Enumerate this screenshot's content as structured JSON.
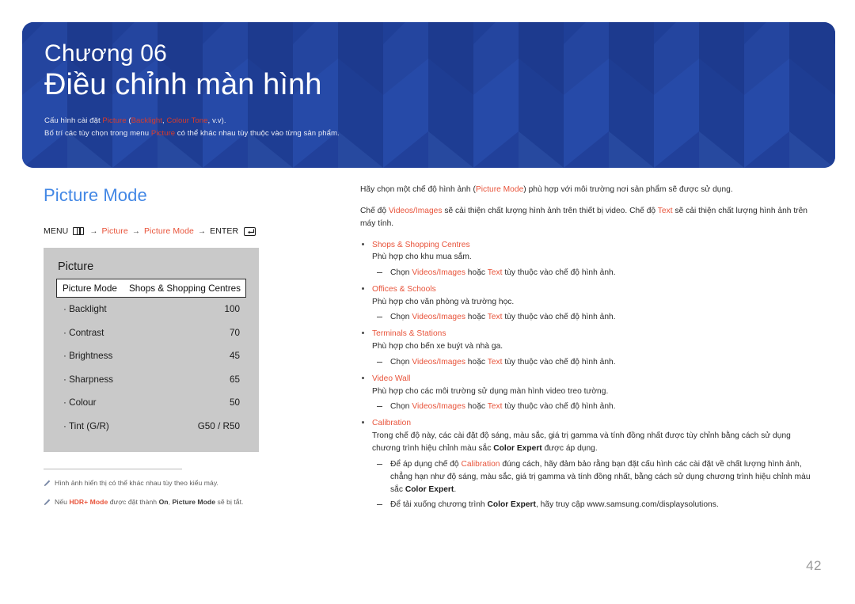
{
  "banner": {
    "chapter_label": "Chương 06",
    "chapter_title": "Điều chỉnh màn hình",
    "note_line1_a": "Cấu hình cài đặt ",
    "note_line1_picture": "Picture",
    "note_line1_b": " (",
    "note_line1_backlight": "Backlight",
    "note_line1_c": ", ",
    "note_line1_colourtone": "Colour Tone",
    "note_line1_d": ", v.v).",
    "note_line2_a": "Bố trí các tùy chọn trong menu ",
    "note_line2_picture": "Picture",
    "note_line2_b": " có thể khác nhau tùy thuộc vào từng sản phẩm.",
    "bg_color": "#21409a",
    "accent_color": "#d93b2b"
  },
  "section": {
    "title": "Picture Mode",
    "title_color": "#4287e5"
  },
  "menu_path": {
    "menu_label": "MENU",
    "menu_icon": "menu-grid-icon",
    "arrow": "→",
    "item1": "Picture",
    "item2": "Picture Mode",
    "enter_label": "ENTER",
    "enter_icon": "enter-return-icon",
    "accent_color": "#e8533a"
  },
  "osd": {
    "title": "Picture",
    "selected_row": {
      "label": "Picture Mode",
      "value": "Shops & Shopping Centres"
    },
    "rows": [
      {
        "label": "Backlight",
        "value": "100"
      },
      {
        "label": "Contrast",
        "value": "70"
      },
      {
        "label": "Brightness",
        "value": "45"
      },
      {
        "label": "Sharpness",
        "value": "65"
      },
      {
        "label": "Colour",
        "value": "50"
      },
      {
        "label": "Tint (G/R)",
        "value": "G50 / R50"
      }
    ],
    "bg_color": "#c9c9c9"
  },
  "footnotes": [
    {
      "icon": "pencil-icon",
      "parts": [
        {
          "text": "Hình ảnh hiển thị có thể khác nhau tùy theo kiểu máy.",
          "style": "normal"
        }
      ]
    },
    {
      "icon": "pencil-icon",
      "parts": [
        {
          "text": "Nếu ",
          "style": "normal"
        },
        {
          "text": "HDR+ Mode",
          "style": "orange"
        },
        {
          "text": " được đặt thành ",
          "style": "normal"
        },
        {
          "text": "On",
          "style": "bold"
        },
        {
          "text": ", ",
          "style": "normal"
        },
        {
          "text": "Picture Mode",
          "style": "bold"
        },
        {
          "text": " sẽ bị tắt.",
          "style": "normal"
        }
      ]
    }
  ],
  "right_column": {
    "para1": [
      {
        "text": "Hãy chọn một chế độ hình ảnh (",
        "style": "normal"
      },
      {
        "text": "Picture Mode",
        "style": "orange"
      },
      {
        "text": ") phù hợp với môi trường nơi sản phẩm sẽ được sử dụng.",
        "style": "normal"
      }
    ],
    "para2": [
      {
        "text": "Chế độ ",
        "style": "normal"
      },
      {
        "text": "Videos/Images",
        "style": "orange"
      },
      {
        "text": " sẽ cải thiện chất lượng hình ảnh trên thiết bị video. Chế độ ",
        "style": "normal"
      },
      {
        "text": "Text",
        "style": "orange"
      },
      {
        "text": " sẽ cải thiện chất lượng hình ảnh trên máy tính.",
        "style": "normal"
      }
    ],
    "bullets": [
      {
        "heading": "Shops & Shopping Centres",
        "body": "Phù hợp cho khu mua sắm.",
        "subs": [
          [
            {
              "text": "Chọn ",
              "style": "normal"
            },
            {
              "text": "Videos/Images",
              "style": "orange"
            },
            {
              "text": " hoặc ",
              "style": "normal"
            },
            {
              "text": "Text",
              "style": "orange"
            },
            {
              "text": " tùy thuộc vào chế độ hình ảnh.",
              "style": "normal"
            }
          ]
        ]
      },
      {
        "heading": "Offices & Schools",
        "body": "Phù hợp cho văn phòng và trường học.",
        "subs": [
          [
            {
              "text": "Chọn ",
              "style": "normal"
            },
            {
              "text": "Videos/Images",
              "style": "orange"
            },
            {
              "text": " hoặc ",
              "style": "normal"
            },
            {
              "text": "Text",
              "style": "orange"
            },
            {
              "text": " tùy thuộc vào chế độ hình ảnh.",
              "style": "normal"
            }
          ]
        ]
      },
      {
        "heading": "Terminals & Stations",
        "body": "Phù hợp cho bến xe buýt và nhà ga.",
        "subs": [
          [
            {
              "text": "Chọn ",
              "style": "normal"
            },
            {
              "text": "Videos/Images",
              "style": "orange"
            },
            {
              "text": " hoặc ",
              "style": "normal"
            },
            {
              "text": "Text",
              "style": "orange"
            },
            {
              "text": " tùy thuộc vào chế độ hình ảnh.",
              "style": "normal"
            }
          ]
        ]
      },
      {
        "heading": "Video Wall",
        "body": "Phù hợp cho các môi trường sử dụng màn hình video treo tường.",
        "subs": [
          [
            {
              "text": "Chọn ",
              "style": "normal"
            },
            {
              "text": "Videos/Images",
              "style": "orange"
            },
            {
              "text": " hoặc ",
              "style": "normal"
            },
            {
              "text": "Text",
              "style": "orange"
            },
            {
              "text": " tùy thuộc vào chế độ hình ảnh.",
              "style": "normal"
            }
          ]
        ]
      },
      {
        "heading": "Calibration",
        "body_parts": [
          {
            "text": "Trong chế độ này, các cài đặt độ sáng, màu sắc, giá trị gamma và tính đồng nhất được tùy chỉnh bằng cách sử dụng chương trình hiệu chỉnh màu sắc ",
            "style": "normal"
          },
          {
            "text": "Color Expert",
            "style": "bold"
          },
          {
            "text": " được áp dụng.",
            "style": "normal"
          }
        ],
        "subs": [
          [
            {
              "text": "Để áp dụng chế độ ",
              "style": "normal"
            },
            {
              "text": "Calibration",
              "style": "orange"
            },
            {
              "text": " đúng cách, hãy đảm bảo rằng bạn đặt cấu hình các cài đặt về chất lượng hình ảnh, chẳng hạn như độ sáng, màu sắc, giá trị gamma và tính đồng nhất, bằng cách sử dụng chương trình hiệu chỉnh màu sắc ",
              "style": "normal"
            },
            {
              "text": "Color Expert",
              "style": "bold"
            },
            {
              "text": ".",
              "style": "normal"
            }
          ],
          [
            {
              "text": "Để tải xuống chương trình ",
              "style": "normal"
            },
            {
              "text": "Color Expert",
              "style": "bold"
            },
            {
              "text": ", hãy truy cập www.samsung.com/displaysolutions.",
              "style": "normal"
            }
          ]
        ]
      }
    ]
  },
  "page_number": "42"
}
